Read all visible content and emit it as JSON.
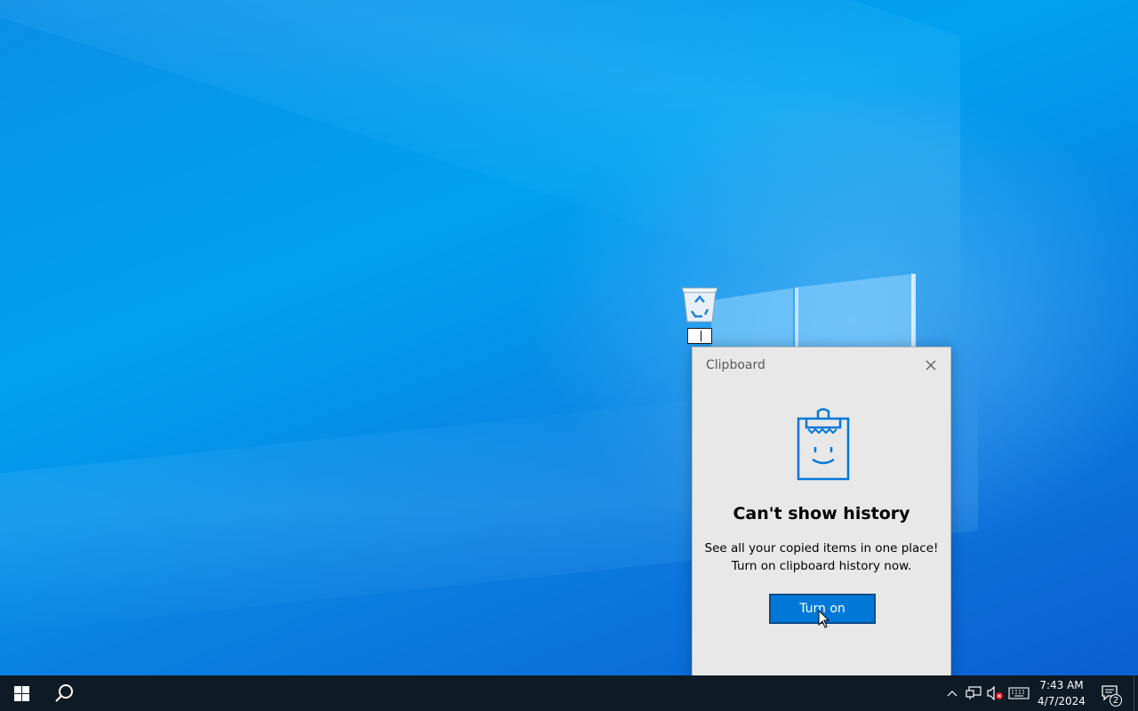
{
  "desktop": {
    "recycle_bin_icon": "recycle-bin-icon",
    "accent_color": "#0078d7"
  },
  "clipboard": {
    "title": "Clipboard",
    "close_icon": "close-icon",
    "illustration": "clipboard-smiley-icon",
    "heading": "Can't show history",
    "body_line1": "See all your copied items in one place!",
    "body_line2": "Turn on clipboard history now.",
    "button_label": "Turn on"
  },
  "taskbar": {
    "start_icon": "windows-logo-icon",
    "search_icon": "search-icon",
    "tray": {
      "chevron_icon": "chevron-up-icon",
      "network_icon": "network-icon",
      "volume_icon": "volume-muted-icon",
      "keyboard_icon": "keyboard-icon"
    },
    "clock": {
      "time": "7:43 AM",
      "date": "4/7/2024"
    },
    "notifications": {
      "icon": "action-center-icon",
      "count": "2"
    }
  }
}
